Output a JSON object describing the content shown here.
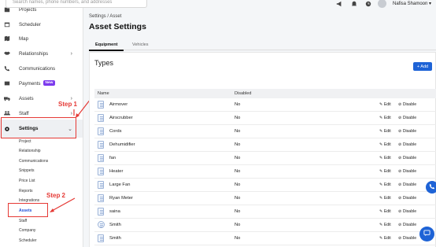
{
  "sidebar": {
    "items": [
      {
        "label": "Projects",
        "icon": "folder-icon"
      },
      {
        "label": "Scheduler",
        "icon": "calendar-icon"
      },
      {
        "label": "Map",
        "icon": "map-icon"
      },
      {
        "label": "Relationships",
        "icon": "handshake-icon"
      },
      {
        "label": "Communications",
        "icon": "phone-icon"
      },
      {
        "label": "Payments",
        "icon": "wallet-icon",
        "badge": "New"
      },
      {
        "label": "Assets",
        "icon": "truck-icon"
      },
      {
        "label": "Staff",
        "icon": "users-icon"
      },
      {
        "label": "Settings",
        "icon": "gear-icon"
      }
    ],
    "settings_sub": [
      "Project",
      "Relationship",
      "Communications",
      "Snippets",
      "Price List",
      "Reports",
      "Integrations",
      "Assets",
      "Staff",
      "Company",
      "Scheduler"
    ]
  },
  "annotations": {
    "step1": "Step 1",
    "step2": "Step 2",
    "color": "#e53935"
  },
  "topbar": {
    "search_placeholder": "Search names, phone numbers, and addresses",
    "username": "Nafisa Shamoon"
  },
  "breadcrumb": "Settings / Asset",
  "page_title": "Asset Settings",
  "tabs": [
    "Equipment",
    "Vehicles"
  ],
  "card": {
    "title": "Types",
    "add_label": "+ Add",
    "columns": [
      "Name",
      "Disabled"
    ],
    "edit_label": "Edit",
    "disable_label": "Disable",
    "rows": [
      {
        "name": "Airmover",
        "disabled": "No"
      },
      {
        "name": "Airscrubber",
        "disabled": "No"
      },
      {
        "name": "Cords",
        "disabled": "No"
      },
      {
        "name": "Dehumidifier",
        "disabled": "No"
      },
      {
        "name": "fan",
        "disabled": "No"
      },
      {
        "name": "Heater",
        "disabled": "No"
      },
      {
        "name": "Large Fan",
        "disabled": "No"
      },
      {
        "name": "Ryan Meter",
        "disabled": "No"
      },
      {
        "name": "saina",
        "disabled": "No"
      },
      {
        "name": "Smith",
        "disabled": "No"
      },
      {
        "name": "Smith",
        "disabled": "No"
      }
    ]
  },
  "colors": {
    "accent": "#1e63d6",
    "badge": "#7c3aed"
  }
}
